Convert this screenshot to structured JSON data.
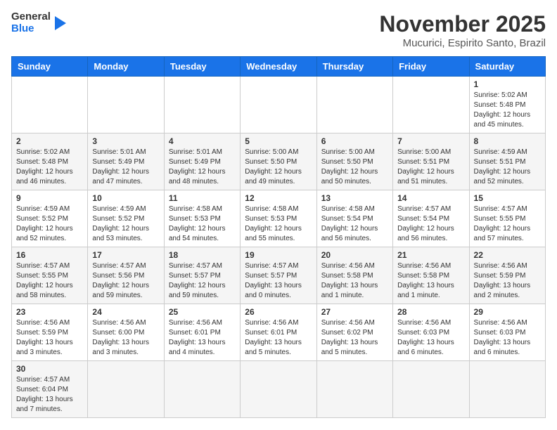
{
  "logo": {
    "text_general": "General",
    "text_blue": "Blue"
  },
  "title": "November 2025",
  "subtitle": "Mucurici, Espirito Santo, Brazil",
  "days_of_week": [
    "Sunday",
    "Monday",
    "Tuesday",
    "Wednesday",
    "Thursday",
    "Friday",
    "Saturday"
  ],
  "weeks": [
    [
      {
        "day": "",
        "info": ""
      },
      {
        "day": "",
        "info": ""
      },
      {
        "day": "",
        "info": ""
      },
      {
        "day": "",
        "info": ""
      },
      {
        "day": "",
        "info": ""
      },
      {
        "day": "",
        "info": ""
      },
      {
        "day": "1",
        "info": "Sunrise: 5:02 AM\nSunset: 5:48 PM\nDaylight: 12 hours and 45 minutes."
      }
    ],
    [
      {
        "day": "2",
        "info": "Sunrise: 5:02 AM\nSunset: 5:48 PM\nDaylight: 12 hours and 46 minutes."
      },
      {
        "day": "3",
        "info": "Sunrise: 5:01 AM\nSunset: 5:49 PM\nDaylight: 12 hours and 47 minutes."
      },
      {
        "day": "4",
        "info": "Sunrise: 5:01 AM\nSunset: 5:49 PM\nDaylight: 12 hours and 48 minutes."
      },
      {
        "day": "5",
        "info": "Sunrise: 5:00 AM\nSunset: 5:50 PM\nDaylight: 12 hours and 49 minutes."
      },
      {
        "day": "6",
        "info": "Sunrise: 5:00 AM\nSunset: 5:50 PM\nDaylight: 12 hours and 50 minutes."
      },
      {
        "day": "7",
        "info": "Sunrise: 5:00 AM\nSunset: 5:51 PM\nDaylight: 12 hours and 51 minutes."
      },
      {
        "day": "8",
        "info": "Sunrise: 4:59 AM\nSunset: 5:51 PM\nDaylight: 12 hours and 52 minutes."
      }
    ],
    [
      {
        "day": "9",
        "info": "Sunrise: 4:59 AM\nSunset: 5:52 PM\nDaylight: 12 hours and 52 minutes."
      },
      {
        "day": "10",
        "info": "Sunrise: 4:59 AM\nSunset: 5:52 PM\nDaylight: 12 hours and 53 minutes."
      },
      {
        "day": "11",
        "info": "Sunrise: 4:58 AM\nSunset: 5:53 PM\nDaylight: 12 hours and 54 minutes."
      },
      {
        "day": "12",
        "info": "Sunrise: 4:58 AM\nSunset: 5:53 PM\nDaylight: 12 hours and 55 minutes."
      },
      {
        "day": "13",
        "info": "Sunrise: 4:58 AM\nSunset: 5:54 PM\nDaylight: 12 hours and 56 minutes."
      },
      {
        "day": "14",
        "info": "Sunrise: 4:57 AM\nSunset: 5:54 PM\nDaylight: 12 hours and 56 minutes."
      },
      {
        "day": "15",
        "info": "Sunrise: 4:57 AM\nSunset: 5:55 PM\nDaylight: 12 hours and 57 minutes."
      }
    ],
    [
      {
        "day": "16",
        "info": "Sunrise: 4:57 AM\nSunset: 5:55 PM\nDaylight: 12 hours and 58 minutes."
      },
      {
        "day": "17",
        "info": "Sunrise: 4:57 AM\nSunset: 5:56 PM\nDaylight: 12 hours and 59 minutes."
      },
      {
        "day": "18",
        "info": "Sunrise: 4:57 AM\nSunset: 5:57 PM\nDaylight: 12 hours and 59 minutes."
      },
      {
        "day": "19",
        "info": "Sunrise: 4:57 AM\nSunset: 5:57 PM\nDaylight: 13 hours and 0 minutes."
      },
      {
        "day": "20",
        "info": "Sunrise: 4:56 AM\nSunset: 5:58 PM\nDaylight: 13 hours and 1 minute."
      },
      {
        "day": "21",
        "info": "Sunrise: 4:56 AM\nSunset: 5:58 PM\nDaylight: 13 hours and 1 minute."
      },
      {
        "day": "22",
        "info": "Sunrise: 4:56 AM\nSunset: 5:59 PM\nDaylight: 13 hours and 2 minutes."
      }
    ],
    [
      {
        "day": "23",
        "info": "Sunrise: 4:56 AM\nSunset: 5:59 PM\nDaylight: 13 hours and 3 minutes."
      },
      {
        "day": "24",
        "info": "Sunrise: 4:56 AM\nSunset: 6:00 PM\nDaylight: 13 hours and 3 minutes."
      },
      {
        "day": "25",
        "info": "Sunrise: 4:56 AM\nSunset: 6:01 PM\nDaylight: 13 hours and 4 minutes."
      },
      {
        "day": "26",
        "info": "Sunrise: 4:56 AM\nSunset: 6:01 PM\nDaylight: 13 hours and 5 minutes."
      },
      {
        "day": "27",
        "info": "Sunrise: 4:56 AM\nSunset: 6:02 PM\nDaylight: 13 hours and 5 minutes."
      },
      {
        "day": "28",
        "info": "Sunrise: 4:56 AM\nSunset: 6:03 PM\nDaylight: 13 hours and 6 minutes."
      },
      {
        "day": "29",
        "info": "Sunrise: 4:56 AM\nSunset: 6:03 PM\nDaylight: 13 hours and 6 minutes."
      }
    ],
    [
      {
        "day": "30",
        "info": "Sunrise: 4:57 AM\nSunset: 6:04 PM\nDaylight: 13 hours and 7 minutes."
      },
      {
        "day": "",
        "info": ""
      },
      {
        "day": "",
        "info": ""
      },
      {
        "day": "",
        "info": ""
      },
      {
        "day": "",
        "info": ""
      },
      {
        "day": "",
        "info": ""
      },
      {
        "day": "",
        "info": ""
      }
    ]
  ]
}
